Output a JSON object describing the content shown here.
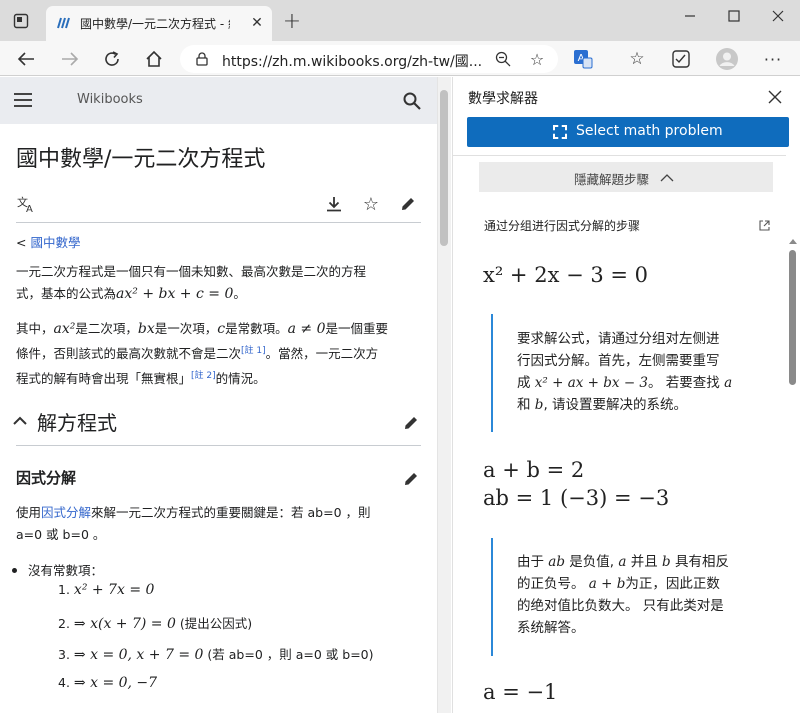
{
  "browser": {
    "tab_title": "國中數學/一元二次方程式 - 維基",
    "url": "https://zh.m.wikibooks.org/zh-tw/國...",
    "window_controls": [
      "minimize",
      "maximize",
      "close"
    ]
  },
  "wiki": {
    "brand": "Wikibooks",
    "title": "國中數學/一元二次方程式",
    "breadcrumb_prefix": "<",
    "breadcrumb_link": "國中數學",
    "intro_1": "一元二次方程式是一個只有一個未知數、最高次數是二次的方程",
    "intro_2a": "式，基本的公式為",
    "intro_2_formula": "ax² + bx + c = 0",
    "intro_2b": "。",
    "p2_1a": "其中，",
    "p2_1_ax2": "ax²",
    "p2_1b": "是二次項，",
    "p2_1_bx": "bx",
    "p2_1c": "是一次項，",
    "p2_1_c": "c",
    "p2_1d": "是常數項。",
    "p2_1_aneq": "a ≠ 0",
    "p2_1e": "是一個重要",
    "p2_2a": "條件，否則該式的最高次數就不會是二次",
    "note1": "[註 1]",
    "p2_2b": "。當然，一元二次方",
    "p2_3a": "程式的解有時會出現「無實根」",
    "note2": "[註 2]",
    "p2_3b": "的情況。",
    "section_title": "解方程式",
    "subsection_title": "因式分解",
    "sub_p1a": "使用",
    "sub_p1_link": "因式分解",
    "sub_p1b": "來解一元二次方程式的重要關鍵是：若 ab=0 ，則",
    "sub_p2": "a=0 或 b=0 。",
    "bullet": "沒有常數項：",
    "list": [
      {
        "num": "1.",
        "math": "x² + 7x = 0",
        "note": ""
      },
      {
        "num": "2.",
        "math": "⇒ x(x + 7) = 0",
        "note": "(提出公因式)"
      },
      {
        "num": "3.",
        "math": "⇒ x = 0, x + 7 = 0",
        "note": "(若 ab=0 ，則 a=0 或 b=0)"
      },
      {
        "num": "4.",
        "math": "⇒ x = 0, −7",
        "note": ""
      }
    ]
  },
  "solver": {
    "title": "數學求解器",
    "select_button": "Select math problem",
    "hide_steps": "隱藏解題步驟",
    "steps_heading": "通过分组进行因式分解的步骤",
    "eq1": "x² + 2x − 3 = 0",
    "note1": {
      "l1": "要求解公式，请通过分组对左侧进",
      "l2": "行因式分解。首先，左侧需要重写",
      "l3a": "成",
      "l3_math": "x² + ax + bx − 3",
      "l3b": "。 若要查找",
      "l3_a": "a",
      "l4a": "和",
      "l4_b": "b",
      "l4b": ", 请设置要解决的系统。"
    },
    "eq2": "a + b = 2",
    "eq3": "ab = 1 (−3) = −3",
    "note2": {
      "l1a": "由于",
      "l1_ab": "ab",
      "l1b": "是负值,",
      "l1_a": "a",
      "l1c": "并且",
      "l1_b": "b",
      "l1d": "具有相反",
      "l2a": "的正负号。",
      "l2_math": "a + b",
      "l2b": "为正，因此正数",
      "l3": "的绝对值比负数大。 只有此类对是",
      "l4": "系统解答。"
    },
    "eq4": "a = −1"
  }
}
